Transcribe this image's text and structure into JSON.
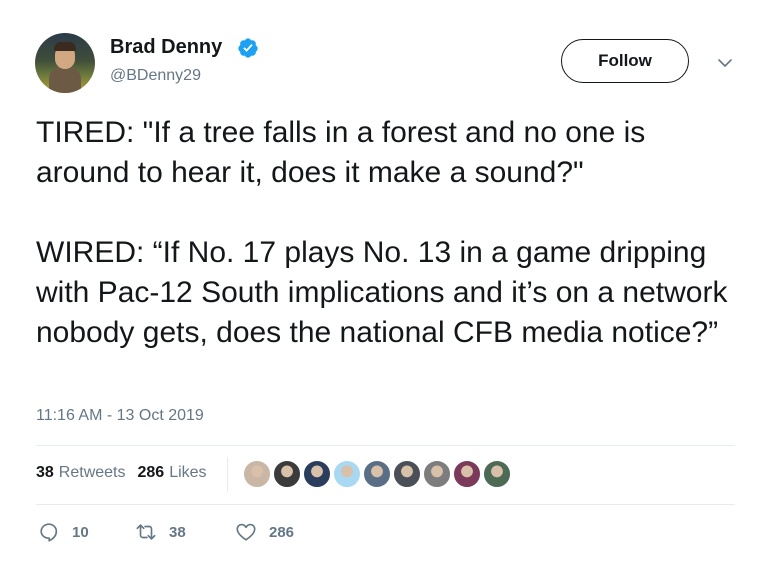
{
  "user": {
    "name": "Brad Denny",
    "handle": "@BDenny29",
    "verified_icon": "verified-badge-icon",
    "verified_color": "#1da1f2"
  },
  "follow_label": "Follow",
  "tweet": {
    "text": "TIRED: \"If a tree falls in a forest and no one is around to hear it, does it make a sound?\"\n\nWIRED: “If No. 17 plays No. 13 in a game dripping with Pac-12 South implications and it’s on a network nobody gets, does the national CFB media notice?”",
    "timestamp": "11:16 AM - 13 Oct 2019"
  },
  "stats": {
    "retweets_count": "38",
    "retweets_label": "Retweets",
    "likes_count": "286",
    "likes_label": "Likes"
  },
  "liker_avatars": [
    {
      "name": "liker-avatar-1",
      "color": "#c9b6a5"
    },
    {
      "name": "liker-avatar-2",
      "color": "#3b3b3b"
    },
    {
      "name": "liker-avatar-3",
      "color": "#2a3d5c"
    },
    {
      "name": "liker-avatar-4",
      "color": "#a9d8f2"
    },
    {
      "name": "liker-avatar-5",
      "color": "#5a6f86"
    },
    {
      "name": "liker-avatar-6",
      "color": "#4a4f58"
    },
    {
      "name": "liker-avatar-7",
      "color": "#7d7d7d"
    },
    {
      "name": "liker-avatar-8",
      "color": "#7b3a5a"
    },
    {
      "name": "liker-avatar-9",
      "color": "#4d6a55"
    }
  ],
  "actions": {
    "reply_count": "10",
    "retweet_count": "38",
    "like_count": "286"
  },
  "colors": {
    "text": "#14171a",
    "secondary": "#657786",
    "divider": "#e6ecf0"
  }
}
